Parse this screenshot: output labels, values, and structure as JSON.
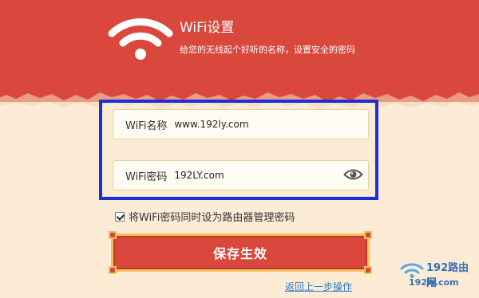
{
  "header": {
    "title": "WiFi设置",
    "subtitle": "给您的无线起个好听的名称，设置安全的密码",
    "icon": "wifi-icon",
    "background_color": "#d9473d"
  },
  "form": {
    "wifi_name": {
      "label": "WiFi名称",
      "value": "www.192ly.com"
    },
    "wifi_password": {
      "label": "WiFi密码",
      "value": "192LY.com",
      "icon": "eye-icon"
    },
    "checkbox": {
      "checked": true,
      "label": "将WiFi密码同时设为路由器管理密码"
    },
    "save_label": "保存生效",
    "back_label": "返回上一步操作"
  },
  "annotation": {
    "color": "#1e2fd8"
  },
  "watermark": {
    "title": "192路由网",
    "url": "192ly.com"
  },
  "colors": {
    "accent": "#d9473d",
    "background": "#fcecd5",
    "link": "#2a78c8",
    "gold_border": "#f0c45a"
  }
}
